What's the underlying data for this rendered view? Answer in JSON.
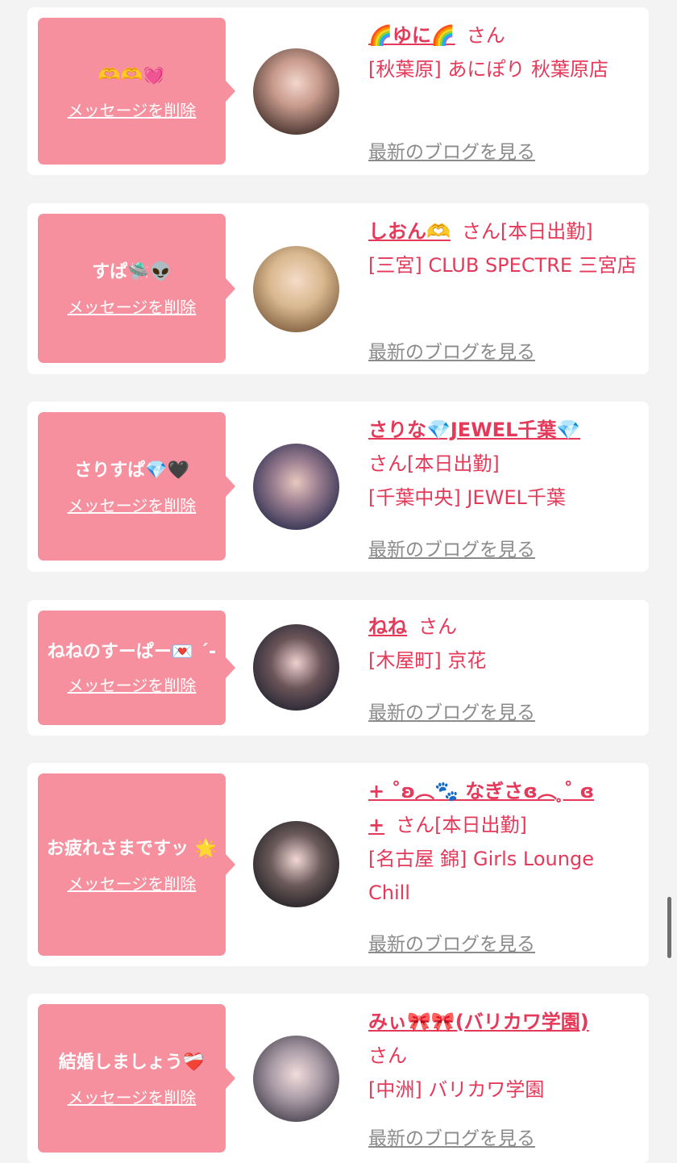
{
  "delete_label": "メッセージを削除",
  "blog_label": "最新のブログを見る",
  "items": [
    {
      "message": "🫶🫶💓",
      "name": "🌈ゆに🌈",
      "honorific": "さん",
      "status": "",
      "shop": "[秋葉原] あにぽり 秋葉原店"
    },
    {
      "message": "すぱ🛸👽",
      "name": "しおん🫶",
      "honorific": "さん",
      "status": "[本日出勤]",
      "shop": "[三宮] CLUB SPECTRE 三宮店"
    },
    {
      "message": "さりすぱ💎🖤",
      "name": "さりな💎JEWEL千葉💎",
      "honorific": "さん",
      "status": "[本日出勤]",
      "shop": "[千葉中央] JEWEL千葉"
    },
    {
      "message": "ねねのすーぱー💌 ´-",
      "name": "ねね",
      "honorific": "さん",
      "status": "",
      "shop": "[木屋町] 京花"
    },
    {
      "message": "お疲れさまですッ 🌟",
      "name": "+ ˚ʚ︵🐾 なぎさɞ︵ ̥˚ ɞ +",
      "honorific": "さん",
      "status": "[本日出勤]",
      "shop": "[名古屋 錦] Girls Lounge Chill"
    },
    {
      "message": "結婚しましょう❤️‍🩹",
      "name": "みぃ🎀🎀(バリカワ学園)",
      "honorific": "さん",
      "status": "",
      "shop": "[中洲] バリカワ学園"
    }
  ],
  "colors": {
    "bubble": "#f7909e",
    "accent": "#e5395a",
    "link_gray": "#8b8b8b",
    "background": "#f3f3f3"
  }
}
